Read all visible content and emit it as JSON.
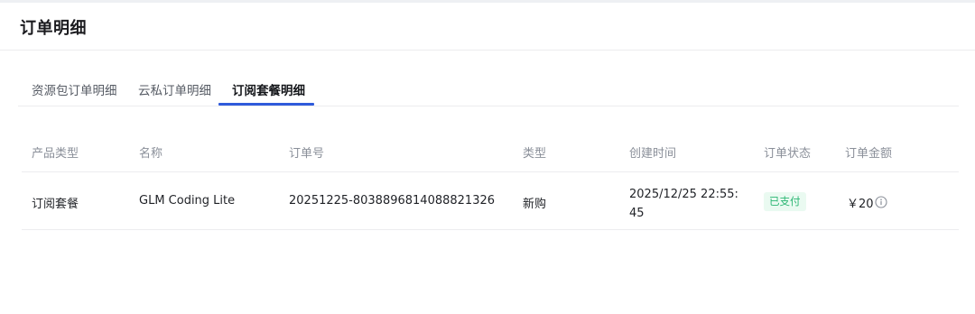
{
  "page": {
    "title": "订单明细"
  },
  "tabs": [
    {
      "label": "资源包订单明细",
      "active": false
    },
    {
      "label": "云私订单明细",
      "active": false
    },
    {
      "label": "订阅套餐明细",
      "active": true
    }
  ],
  "table": {
    "columns": [
      "产品类型",
      "名称",
      "订单号",
      "类型",
      "创建时间",
      "订单状态",
      "订单金额"
    ],
    "rows": [
      {
        "product_type": "订阅套餐",
        "name": "GLM Coding Lite",
        "order_no": "20251225-8038896814088821326",
        "type": "新购",
        "created_at": "2025/12/25 22:55:45",
        "status": "已支付",
        "amount": "￥20"
      }
    ]
  },
  "colors": {
    "accent": "#2f5bdb",
    "status_paid_text": "#2bb673",
    "status_paid_bg": "#eafaf1"
  },
  "icons": {
    "amount_info": "info-circle-icon"
  }
}
